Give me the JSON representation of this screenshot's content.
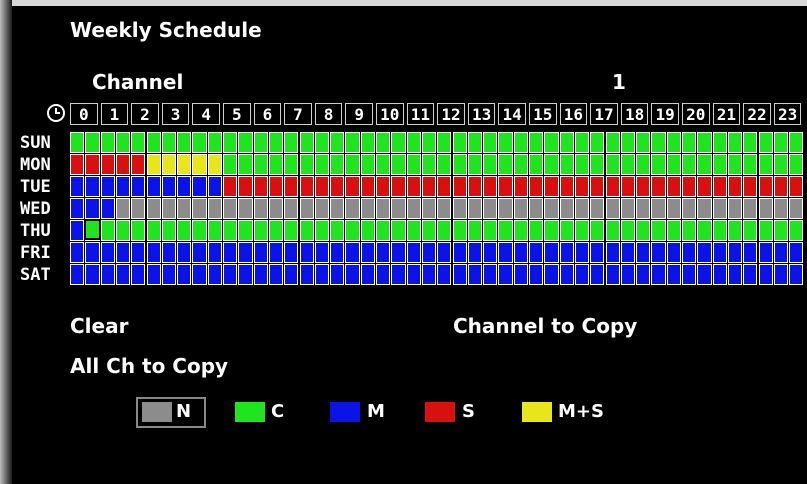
{
  "title": "Weekly Schedule",
  "channel_label": "Channel",
  "channel_value": "1",
  "hours": [
    "0",
    "1",
    "2",
    "3",
    "4",
    "5",
    "6",
    "7",
    "8",
    "9",
    "10",
    "11",
    "12",
    "13",
    "14",
    "15",
    "16",
    "17",
    "18",
    "19",
    "20",
    "21",
    "22",
    "23"
  ],
  "days": [
    "SUN",
    "MON",
    "TUE",
    "WED",
    "THU",
    "FRI",
    "SAT"
  ],
  "colors": {
    "N": "#8c8c8c",
    "C": "#1fe51f",
    "M": "#0a14e6",
    "S": "#d8110f",
    "M+S": "#e6e61a"
  },
  "schedule": [
    [
      "C",
      "C",
      "C",
      "C",
      "C",
      "C",
      "C",
      "C",
      "C",
      "C",
      "C",
      "C",
      "C",
      "C",
      "C",
      "C",
      "C",
      "C",
      "C",
      "C",
      "C",
      "C",
      "C",
      "C",
      "C",
      "C",
      "C",
      "C",
      "C",
      "C",
      "C",
      "C",
      "C",
      "C",
      "C",
      "C",
      "C",
      "C",
      "C",
      "C",
      "C",
      "C",
      "C",
      "C",
      "C",
      "C",
      "C",
      "C"
    ],
    [
      "S",
      "S",
      "S",
      "S",
      "S",
      "M+S",
      "M+S",
      "M+S",
      "M+S",
      "M+S",
      "C",
      "C",
      "C",
      "C",
      "C",
      "C",
      "C",
      "C",
      "C",
      "C",
      "C",
      "C",
      "C",
      "C",
      "C",
      "C",
      "C",
      "C",
      "C",
      "C",
      "C",
      "C",
      "C",
      "C",
      "C",
      "C",
      "C",
      "C",
      "C",
      "C",
      "C",
      "C",
      "C",
      "C",
      "C",
      "C",
      "C",
      "C"
    ],
    [
      "M",
      "M",
      "M",
      "M",
      "M",
      "M",
      "M",
      "M",
      "M",
      "M",
      "S",
      "S",
      "S",
      "S",
      "S",
      "S",
      "S",
      "S",
      "S",
      "S",
      "S",
      "S",
      "S",
      "S",
      "S",
      "S",
      "S",
      "S",
      "S",
      "S",
      "S",
      "S",
      "S",
      "S",
      "S",
      "S",
      "S",
      "S",
      "S",
      "S",
      "S",
      "S",
      "S",
      "S",
      "S",
      "S",
      "S",
      "S"
    ],
    [
      "M",
      "M",
      "M",
      "N",
      "N",
      "N",
      "N",
      "N",
      "N",
      "N",
      "N",
      "N",
      "N",
      "N",
      "N",
      "N",
      "N",
      "N",
      "N",
      "N",
      "N",
      "N",
      "N",
      "N",
      "N",
      "N",
      "N",
      "N",
      "N",
      "N",
      "N",
      "N",
      "N",
      "N",
      "N",
      "N",
      "N",
      "N",
      "N",
      "N",
      "N",
      "N",
      "N",
      "N",
      "N",
      "N",
      "N",
      "N"
    ],
    [
      "M",
      "C",
      "C",
      "C",
      "C",
      "C",
      "C",
      "C",
      "C",
      "C",
      "C",
      "C",
      "C",
      "C",
      "C",
      "C",
      "C",
      "C",
      "C",
      "C",
      "C",
      "C",
      "C",
      "C",
      "C",
      "C",
      "C",
      "C",
      "C",
      "C",
      "C",
      "C",
      "C",
      "C",
      "C",
      "C",
      "C",
      "C",
      "C",
      "C",
      "C",
      "C",
      "C",
      "C",
      "C",
      "C",
      "C",
      "C"
    ],
    [
      "M",
      "M",
      "M",
      "M",
      "M",
      "M",
      "M",
      "M",
      "M",
      "M",
      "M",
      "M",
      "M",
      "M",
      "M",
      "M",
      "M",
      "M",
      "M",
      "M",
      "M",
      "M",
      "M",
      "M",
      "M",
      "M",
      "M",
      "M",
      "M",
      "M",
      "M",
      "M",
      "M",
      "M",
      "M",
      "M",
      "M",
      "M",
      "M",
      "M",
      "M",
      "M",
      "M",
      "M",
      "M",
      "M",
      "M",
      "M"
    ],
    [
      "M",
      "M",
      "M",
      "M",
      "M",
      "M",
      "M",
      "M",
      "M",
      "M",
      "M",
      "M",
      "M",
      "M",
      "M",
      "M",
      "M",
      "M",
      "M",
      "M",
      "M",
      "M",
      "M",
      "M",
      "M",
      "M",
      "M",
      "M",
      "M",
      "M",
      "M",
      "M",
      "M",
      "M",
      "M",
      "M",
      "M",
      "M",
      "M",
      "M",
      "M",
      "M",
      "M",
      "M",
      "M",
      "M",
      "M",
      "M"
    ]
  ],
  "actions": {
    "clear": "Clear",
    "channel_to_copy": "Channel to Copy",
    "all_ch_to_copy": "All Ch to Copy"
  },
  "legend": [
    {
      "key": "N",
      "label": "N",
      "icon": "gray-swatch"
    },
    {
      "key": "C",
      "label": "C",
      "icon": "green-swatch"
    },
    {
      "key": "M",
      "label": "M",
      "icon": "blue-swatch"
    },
    {
      "key": "S",
      "label": "S",
      "icon": "red-swatch"
    },
    {
      "key": "M+S",
      "label": "M+S",
      "icon": "yellow-swatch"
    }
  ]
}
